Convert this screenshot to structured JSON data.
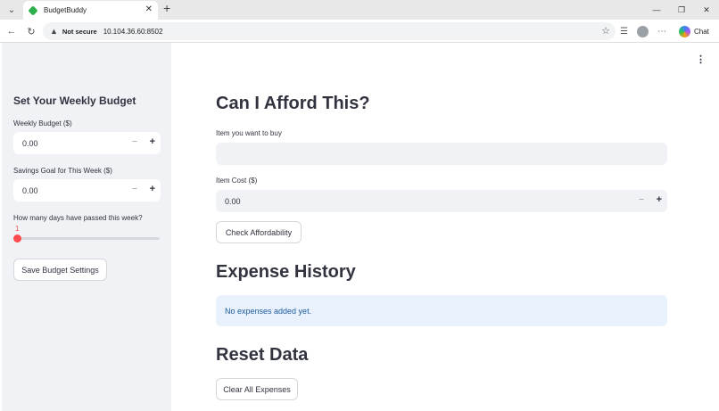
{
  "browser": {
    "tab_title": "BudgetBuddy",
    "not_secure_label": "Not secure",
    "url": "10.104.36.60:8502",
    "chat_label": "Chat"
  },
  "sidebar": {
    "title": "Set Your Weekly Budget",
    "weekly_budget": {
      "label": "Weekly Budget ($)",
      "value": "0.00"
    },
    "savings_goal": {
      "label": "Savings Goal for This Week ($)",
      "value": "0.00"
    },
    "days_passed": {
      "label": "How many days have passed this week?",
      "value": "1"
    },
    "save_button": "Save Budget Settings"
  },
  "main": {
    "afford_title": "Can I Afford This?",
    "item_label": "Item you want to buy",
    "item_value": "",
    "cost_label": "Item Cost ($)",
    "cost_value": "0.00",
    "check_button": "Check Affordability",
    "history_title": "Expense History",
    "history_info": "No expenses added yet.",
    "reset_title": "Reset Data",
    "clear_button": "Clear All Expenses"
  },
  "colors": {
    "accent": "#ff4b4b",
    "sidebar_bg": "#f0f2f6",
    "info_bg": "#e8f1fc",
    "info_text": "#1e5a9c"
  }
}
